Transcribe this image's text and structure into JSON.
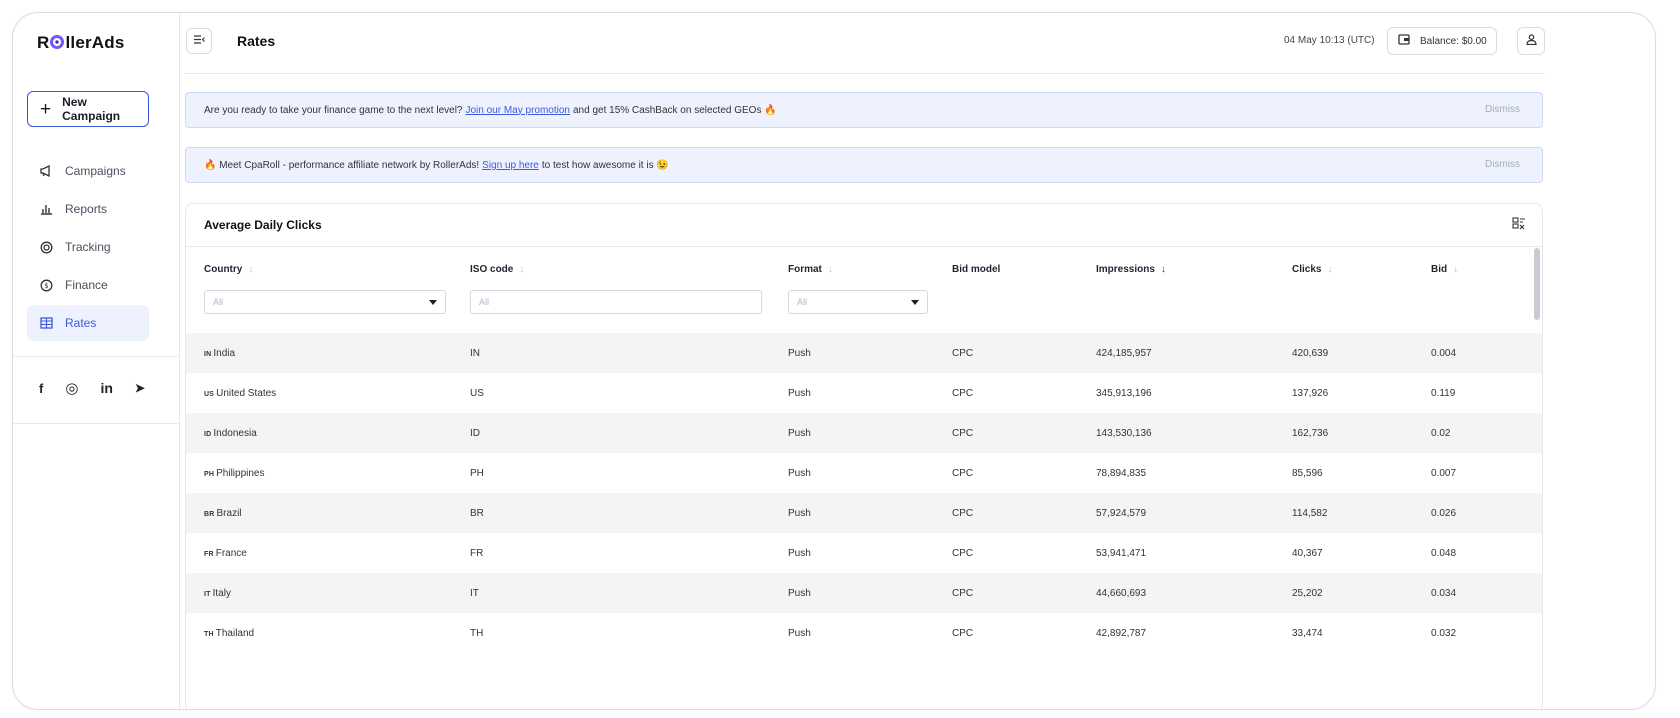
{
  "brand": {
    "logo_left": "R",
    "logo_right": "llerAds"
  },
  "sidebar": {
    "new_campaign": "New Campaign",
    "items": [
      {
        "label": "Campaigns",
        "icon": "megaphone-icon"
      },
      {
        "label": "Reports",
        "icon": "reports-icon"
      },
      {
        "label": "Tracking",
        "icon": "tracking-icon"
      },
      {
        "label": "Finance",
        "icon": "finance-icon"
      },
      {
        "label": "Rates",
        "icon": "rates-icon",
        "active": true
      }
    ],
    "socials": {
      "facebook": "f",
      "instagram": "◎",
      "linkedin": "in",
      "telegram": "➤"
    }
  },
  "header": {
    "title": "Rates",
    "datetime": "04 May 10:13 (UTC)",
    "balance": "Balance: $0.00"
  },
  "banners": [
    {
      "pre": "Are you ready to take your finance game to the next level?",
      "link": "Join our May promotion",
      "post": "and get 15% CashBack on selected GEOs 🔥",
      "dismiss": "Dismiss"
    },
    {
      "pre": "🔥 Meet CpaRoll - performance affiliate network by RollerAds!",
      "link": "Sign up here",
      "post": "to test how awesome it is 😉",
      "dismiss": "Dismiss"
    }
  ],
  "table": {
    "title": "Average Daily Clicks",
    "columns": {
      "country": "Country",
      "iso": "ISO code",
      "format": "Format",
      "bid_model": "Bid model",
      "impressions": "Impressions",
      "clicks": "Clicks",
      "bid": "Bid"
    },
    "filters": {
      "country": "All",
      "iso": "All",
      "format": "All"
    },
    "rows": [
      {
        "cc": "IN",
        "country": "India",
        "iso": "IN",
        "format": "Push",
        "bid_model": "CPC",
        "impressions": "424,185,957",
        "clicks": "420,639",
        "bid": "0.004"
      },
      {
        "cc": "US",
        "country": "United States",
        "iso": "US",
        "format": "Push",
        "bid_model": "CPC",
        "impressions": "345,913,196",
        "clicks": "137,926",
        "bid": "0.119"
      },
      {
        "cc": "ID",
        "country": "Indonesia",
        "iso": "ID",
        "format": "Push",
        "bid_model": "CPC",
        "impressions": "143,530,136",
        "clicks": "162,736",
        "bid": "0.02"
      },
      {
        "cc": "PH",
        "country": "Philippines",
        "iso": "PH",
        "format": "Push",
        "bid_model": "CPC",
        "impressions": "78,894,835",
        "clicks": "85,596",
        "bid": "0.007"
      },
      {
        "cc": "BR",
        "country": "Brazil",
        "iso": "BR",
        "format": "Push",
        "bid_model": "CPC",
        "impressions": "57,924,579",
        "clicks": "114,582",
        "bid": "0.026"
      },
      {
        "cc": "FR",
        "country": "France",
        "iso": "FR",
        "format": "Push",
        "bid_model": "CPC",
        "impressions": "53,941,471",
        "clicks": "40,367",
        "bid": "0.048"
      },
      {
        "cc": "IT",
        "country": "Italy",
        "iso": "IT",
        "format": "Push",
        "bid_model": "CPC",
        "impressions": "44,660,693",
        "clicks": "25,202",
        "bid": "0.034"
      },
      {
        "cc": "TH",
        "country": "Thailand",
        "iso": "TH",
        "format": "Push",
        "bid_model": "CPC",
        "impressions": "42,892,787",
        "clicks": "33,474",
        "bid": "0.032"
      }
    ]
  },
  "colors": {
    "accent": "#3b5bdb",
    "banner_bg": "#eef2ff",
    "row_alt": "#f3f4f6"
  }
}
